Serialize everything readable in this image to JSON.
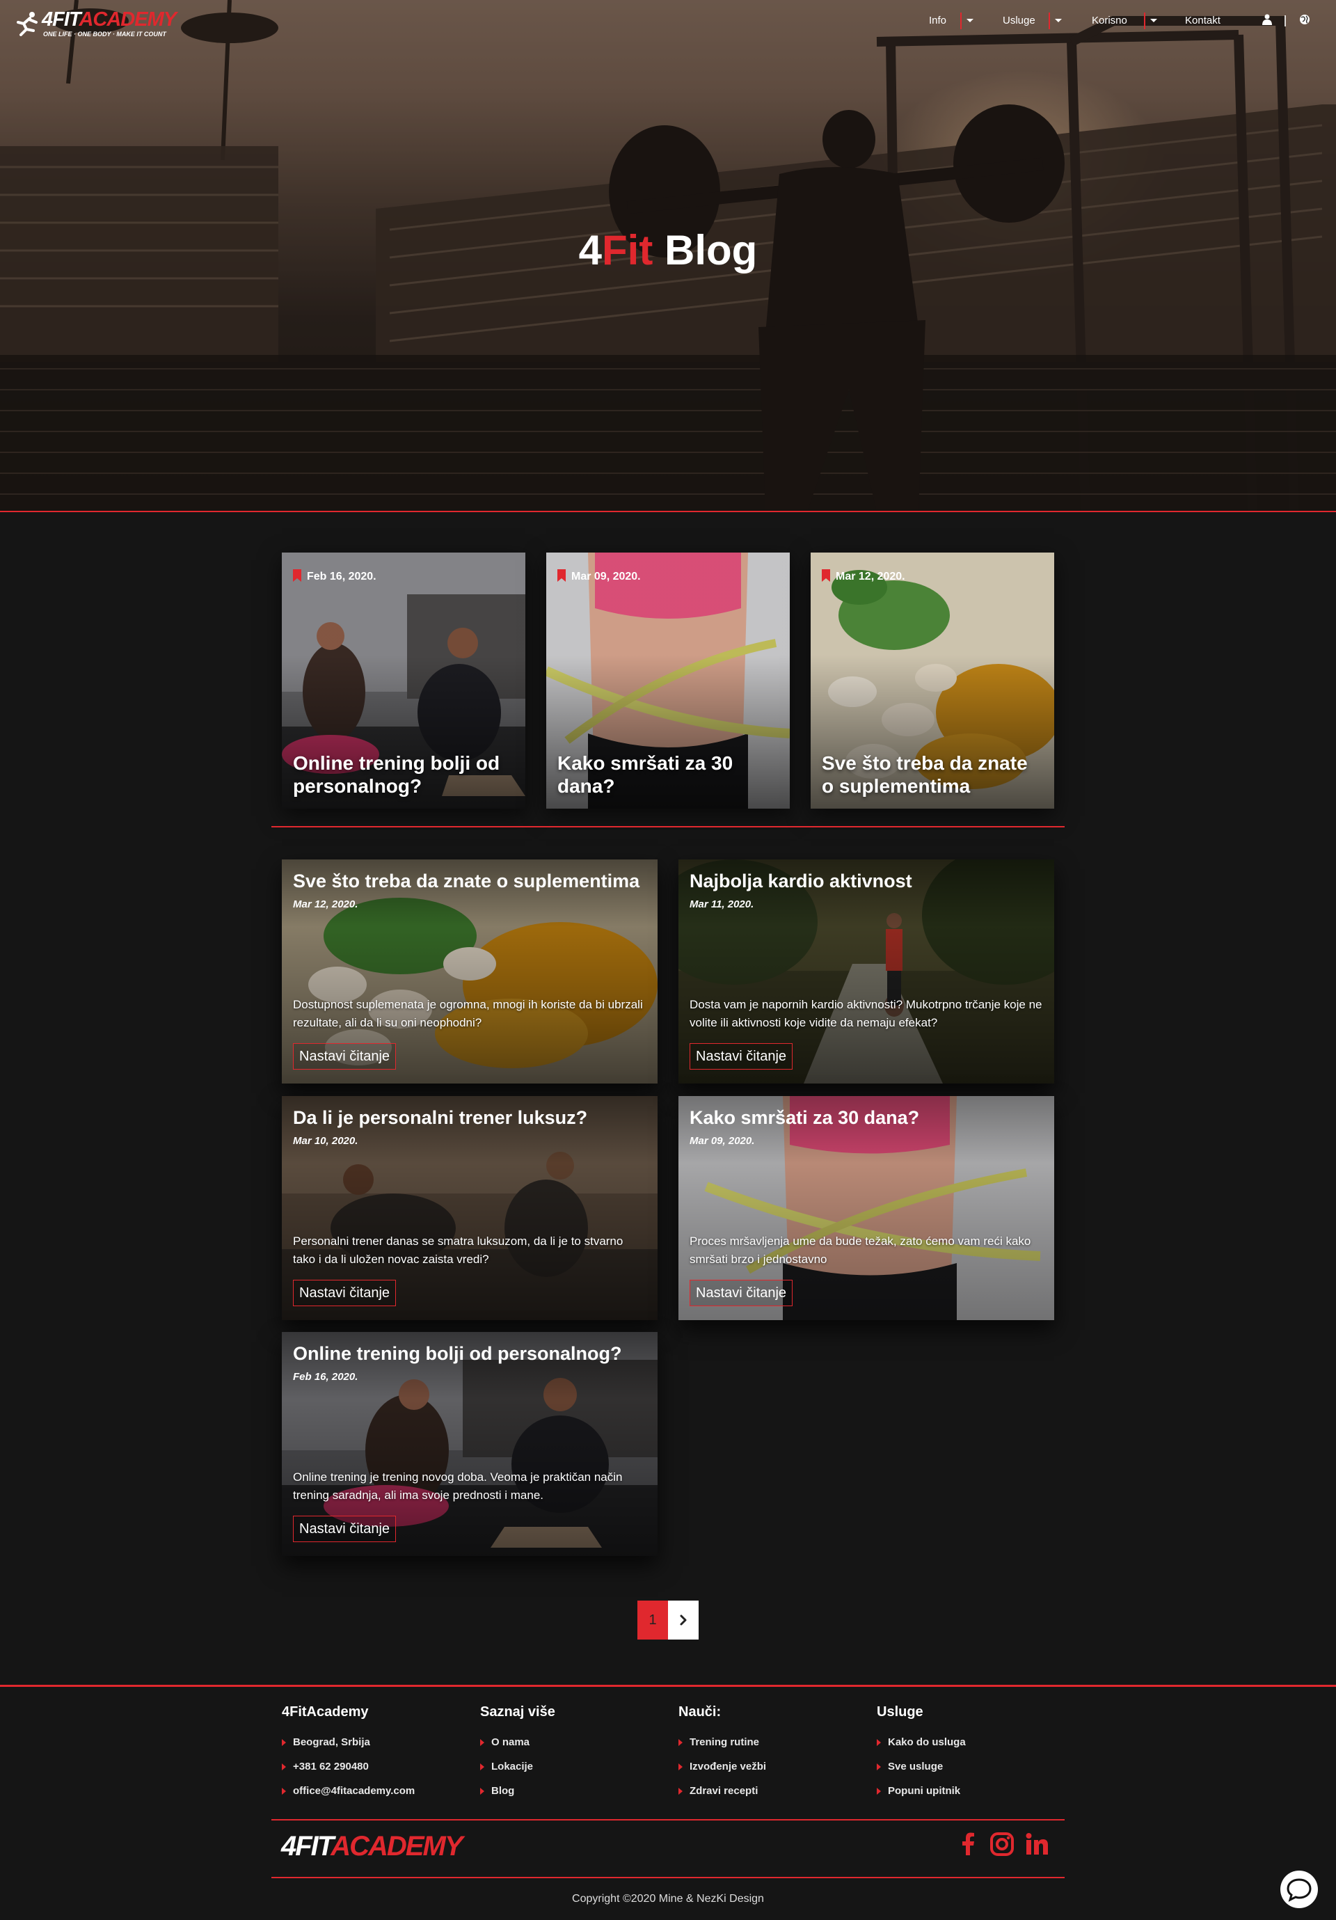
{
  "header": {
    "logo": {
      "word_a": "4FIT",
      "word_b": "ACADEMY",
      "tagline": "ONE LIFE · ONE BODY · MAKE IT COUNT"
    },
    "nav": [
      {
        "label": "Info",
        "dropdown": true
      },
      {
        "label": "Usluge",
        "dropdown": true
      },
      {
        "label": "Korisno",
        "dropdown": true
      },
      {
        "label": "Kontakt",
        "dropdown": false
      }
    ],
    "icons": [
      "user-icon",
      "globe-icon"
    ]
  },
  "hero": {
    "title_a": "4",
    "title_b": "Fit",
    "title_c": " Blog"
  },
  "featured": [
    {
      "date": "Feb 16, 2020.",
      "title": "Online trening bolji od personalnog?",
      "image": "training-couple"
    },
    {
      "date": "Mar 09, 2020.",
      "title": "Kako smršati za 30 dana?",
      "image": "measuring-tape"
    },
    {
      "date": "Mar 12, 2020.",
      "title": "Sve što treba da znate o suplementima",
      "image": "supplements"
    }
  ],
  "posts": [
    {
      "title": "Sve što treba da znate o suplementima",
      "date": "Mar 12, 2020.",
      "excerpt": "Dostupnost suplemenata je ogromna, mnogi ih koriste da bi ubrzali rezultate, ali da li su oni neophodni?",
      "button": "Nastavi čitanje",
      "image": "supplements"
    },
    {
      "title": "Najbolja kardio aktivnost",
      "date": "Mar 11, 2020.",
      "excerpt": "Dosta vam je napornih kardio aktivnosti? Mukotrpno trčanje koje ne volite ili aktivnosti koje vidite da nemaju efekat?",
      "button": "Nastavi čitanje",
      "image": "runner"
    },
    {
      "title": "Da li je personalni trener luksuz?",
      "date": "Mar 10, 2020.",
      "excerpt": "Personalni trener danas se smatra luksuzom, da li je to stvarno tako i da li uložen novac zaista vredi?",
      "button": "Nastavi čitanje",
      "image": "trainer"
    },
    {
      "title": "Kako smršati za 30 dana?",
      "date": "Mar 09, 2020.",
      "excerpt": "Proces mršavljenja ume da bude težak, zato ćemo vam reći kako smršati brzo i jednostavno",
      "button": "Nastavi čitanje",
      "image": "measuring-tape"
    },
    {
      "title": "Online trening bolji od personalnog?",
      "date": "Feb 16, 2020.",
      "excerpt": "Online trening je trening novog doba. Veoma je praktičan način trening saradnja, ali ima svoje prednosti i mane.",
      "button": "Nastavi čitanje",
      "image": "training-couple"
    }
  ],
  "pagination": {
    "current": "1",
    "next_icon": "chevron-right-icon"
  },
  "footer": {
    "columns": [
      {
        "heading": "4FitAcademy",
        "items": [
          "Beograd, Srbija",
          "+381 62 290480",
          "office@4fitacademy.com"
        ]
      },
      {
        "heading": "Saznaj više",
        "items": [
          "O nama",
          "Lokacije",
          "Blog"
        ]
      },
      {
        "heading": "Nauči:",
        "items": [
          "Trening rutine",
          "Izvođenje vežbi",
          "Zdravi recepti"
        ]
      },
      {
        "heading": "Usluge",
        "items": [
          "Kako do usluga",
          "Sve usluge",
          "Popuni upitnik"
        ]
      }
    ],
    "logo": {
      "word_a": "4FIT",
      "word_b": "ACADEMY"
    },
    "social": [
      "facebook-icon",
      "instagram-icon",
      "linkedin-icon"
    ],
    "copyright": "Copyright ©2020 Mine & NezKi Design"
  },
  "colors": {
    "accent": "#e0282e",
    "background": "#151515"
  }
}
